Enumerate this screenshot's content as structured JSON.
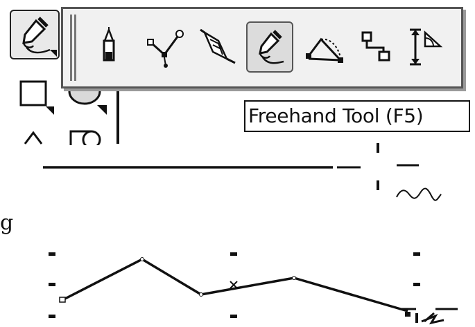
{
  "toolbox": {
    "tools": [
      {
        "name": "freehand-tool-group",
        "icon": "freehand-pen-icon",
        "active": true
      },
      {
        "name": "rectangle-tool",
        "icon": "rectangle-icon"
      },
      {
        "name": "ellipse-tool",
        "icon": "ellipse-icon"
      },
      {
        "name": "polygon-tool",
        "icon": "polygon-icon"
      },
      {
        "name": "basic-shapes-tool",
        "icon": "basic-shapes-icon"
      }
    ]
  },
  "flyout": {
    "tools": [
      {
        "name": "artistic-media-tool",
        "icon": "artistic-media-icon"
      },
      {
        "name": "bezier-tool",
        "icon": "bezier-icon"
      },
      {
        "name": "smart-drawing-tool",
        "icon": "smart-drawing-icon"
      },
      {
        "name": "freehand-tool",
        "icon": "freehand-icon",
        "selected": true
      },
      {
        "name": "3-point-curve-tool",
        "icon": "3-point-curve-icon"
      },
      {
        "name": "connector-tool",
        "icon": "connector-icon"
      },
      {
        "name": "dimension-tool",
        "icon": "dimension-icon"
      }
    ]
  },
  "tooltip": {
    "text": "Freehand Tool (F5)"
  },
  "page_text": {
    "partial_char": "g"
  }
}
